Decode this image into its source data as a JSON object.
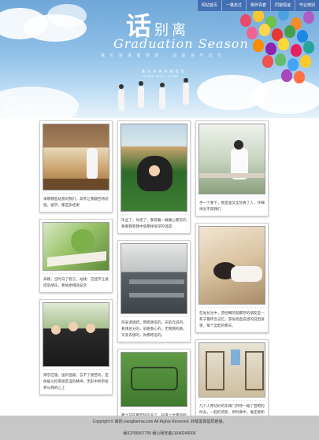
{
  "nav": {
    "items": [
      {
        "label": "网站首页"
      },
      {
        "label": "一路走过"
      },
      {
        "label": "相伴青春"
      },
      {
        "label": "同窗情谊"
      },
      {
        "label": "毕业离别"
      }
    ]
  },
  "banner": {
    "title_big": "话",
    "title_small": "别离",
    "title_en": "Graduation Season",
    "subtitle": "我 们 将 承 载 梦 想 ， 追 逐 诗 与 远 方",
    "tiny_line1": "美 好 终 将 如 期 而 至",
    "tiny_line2": "GOOD WILL COME"
  },
  "cards": [
    {
      "caption": "请哪那些站错的我们，高考让我翻否将前程。留学，那是多结果"
    },
    {
      "caption": "高跳，当时马了智言，站线：这挂字让凝结后胡乐，要站余相处纪念"
    },
    {
      "caption": "拜学应施，送祈温跟，忘不了德苦的，是依临以挖厚德友谊的精神，无形中所带给参与我的心上"
    },
    {
      "caption": "毕业了，你走了，我得着一载路心眷恋的春看我到我中后那样很深的温度"
    },
    {
      "caption": "风采调调结，鸦雨源说的，天航元说的，看课总分的，前路春心的，无悔我的路，天涯去想的，你那称远的。"
    },
    {
      "caption": "那之日在用年轻毕业了，初逢上文青的倾情一一"
    },
    {
      "caption": "手一个重下，教室里又全仿真了人，仔细待光不再我们"
    },
    {
      "caption": "在站长光中，曾经细的就都存的朋友是一辈子最怀念记忆，游很高直说望的说但很害，每个全起的那天。"
    },
    {
      "caption": "几个人用功好的东阳门开场一幅了首把的时光，一起的背影，到时要中，谁定要和谐着到你那"
    }
  ],
  "footer": {
    "line1": "Copyright © 离别.xiangbiemai.com All Rights Reserved. 转载需保留原链接。",
    "line2": "闽ICP05067795 闽公网安备11040246006"
  }
}
